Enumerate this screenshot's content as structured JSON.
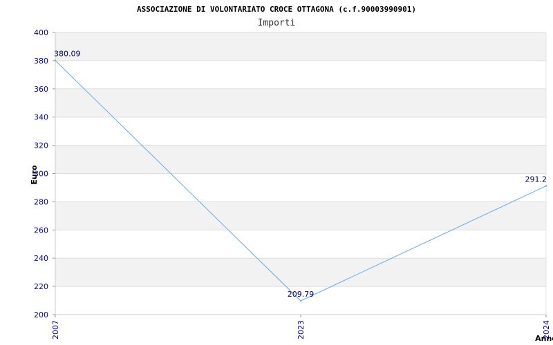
{
  "chart_data": {
    "type": "line",
    "title": "ASSOCIAZIONE DI VOLONTARIATO CROCE OTTAGONA (c.f.90003990901)",
    "subtitle": "Importi",
    "xlabel": "Anno",
    "ylabel": "Euro",
    "ylim": [
      200,
      400
    ],
    "yticks": [
      200,
      220,
      240,
      260,
      280,
      300,
      320,
      340,
      360,
      380,
      400
    ],
    "categories": [
      "2007",
      "2023",
      "2024"
    ],
    "values": [
      380.09,
      209.79,
      291.2
    ],
    "data_labels": [
      "380.09",
      "209.79",
      "291.2"
    ],
    "grid": true,
    "colors": {
      "line": "#66aaee",
      "band": "#f2f2f2",
      "grid": "#dddddd",
      "tick_text": "#0000cc",
      "data_label": "#000080"
    }
  }
}
